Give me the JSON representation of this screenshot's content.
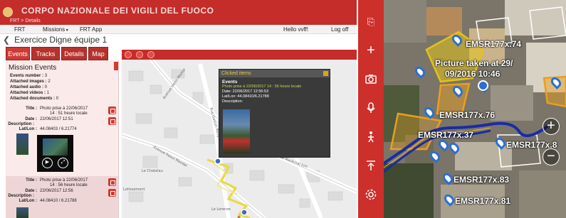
{
  "web": {
    "header": {
      "org_name": "CORPO NAZIONALE DEI VIGILI DEL FUOCO",
      "breadcrumb": "FRT > Details"
    },
    "nav": {
      "home": "FRT",
      "missions": "Missions",
      "frt_app": "FRT App",
      "greeting": "Hello vvff!",
      "logoff": "Log off"
    },
    "page_title": "Exercice Digne équipe 1",
    "tabs": [
      "Events",
      "Tracks",
      "Details",
      "Map"
    ],
    "mission_events": {
      "heading": "Mission Events",
      "stats": [
        {
          "label": "Events number :",
          "value": "3"
        },
        {
          "label": "Attached images :",
          "value": "2"
        },
        {
          "label": "Attached audio :",
          "value": "0"
        },
        {
          "label": "Attached videos :",
          "value": "1"
        },
        {
          "label": "Attached documents :",
          "value": "0"
        }
      ],
      "entries": [
        {
          "title_label": "Title :",
          "title": "Photo prise à 22/06/2017",
          "title2": "14 : 51 heure locale",
          "date_label": "Date :",
          "date": "22/06/2017 12:51",
          "desc_label": "Description :",
          "desc": "",
          "latlon_label": "Lat/Lon :",
          "latlon": "44.08403 / 6.21774"
        },
        {
          "title_label": "Title :",
          "title": "Photo prise à 22/06/2017",
          "title2": "14 : 56 heure locale",
          "date_label": "Date :",
          "date": "22/06/2017 12:56",
          "desc_label": "Description :",
          "desc": "",
          "latlon_label": "Lat/Lon :",
          "latlon": "44.08410 / 6.21788"
        }
      ]
    },
    "popup": {
      "title": "Clicked items",
      "section": "Events",
      "item_title": "Photo prise à 22/06/2017 14 : 56 heure locale",
      "date": "Date: 22/06/2017 12:56:53",
      "latlon": "Lat/Lon: 44.08410/6.21788",
      "description": "Description:"
    },
    "map_streets": [
      "Avenue Henri Mortur",
      "Rue Gaston Rougier",
      "Avenue Raoul Mandel",
      "Avenue Maréchal Juin",
      "Le Chatelau",
      "Lotissement",
      "Le Lorenze"
    ]
  },
  "mobile": {
    "sidebar_icons": [
      "export-icon",
      "add-icon",
      "camera-icon",
      "microphone-icon",
      "person-walk-icon",
      "upload-icon",
      "settings-icon"
    ],
    "labels": {
      "l1": "EMSR177x.74",
      "l2a": "Picture taken at 29/",
      "l2b": "09/2016 10:46",
      "l3": "EMSR177x.76",
      "l4": "EMSR177x.37",
      "l5": "EMSR177x.8",
      "l6": "EMSR177x.83",
      "l7": "EMSR177x.81"
    },
    "zoom_in": "+",
    "zoom_out": "−"
  },
  "colors": {
    "brand_red": "#c42d2a",
    "track_blue": "#1b2aa8",
    "polygon_yellow": "#e3c21a"
  }
}
